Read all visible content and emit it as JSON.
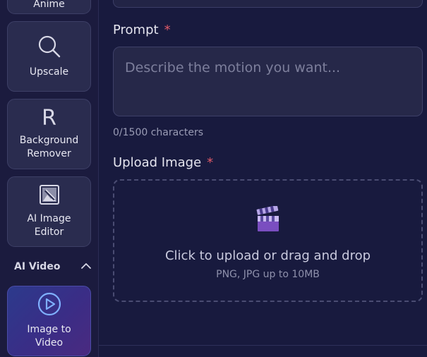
{
  "sidebar": {
    "tools": [
      {
        "label": "Anime",
        "icon": "anime-icon"
      },
      {
        "label": "Upscale",
        "icon": "magnifier-icon"
      },
      {
        "label": "Background\nRemover",
        "icon_glyph": "R",
        "icon": "background-remover-icon"
      },
      {
        "label": "AI Image\nEditor",
        "icon": "image-edit-icon"
      },
      {
        "label": "Image to\nVideo",
        "icon": "play-circle-icon",
        "active": true
      }
    ],
    "section": {
      "title": "AI Video",
      "icon": "chevron-up-icon"
    }
  },
  "form": {
    "prompt": {
      "label": "Prompt",
      "required_mark": "*",
      "placeholder": "Describe the motion you want...",
      "counter": "0/1500 characters"
    },
    "upload": {
      "label": "Upload Image",
      "required_mark": "*",
      "icon": "clapperboard-icon",
      "title": "Click to upload or drag and drop",
      "subtitle": "PNG, JPG up to 10MB"
    }
  },
  "colors": {
    "background": "#181a3e",
    "card": "#2a2c4f",
    "accent_active": "#3a2d86",
    "required": "#e05a68"
  }
}
